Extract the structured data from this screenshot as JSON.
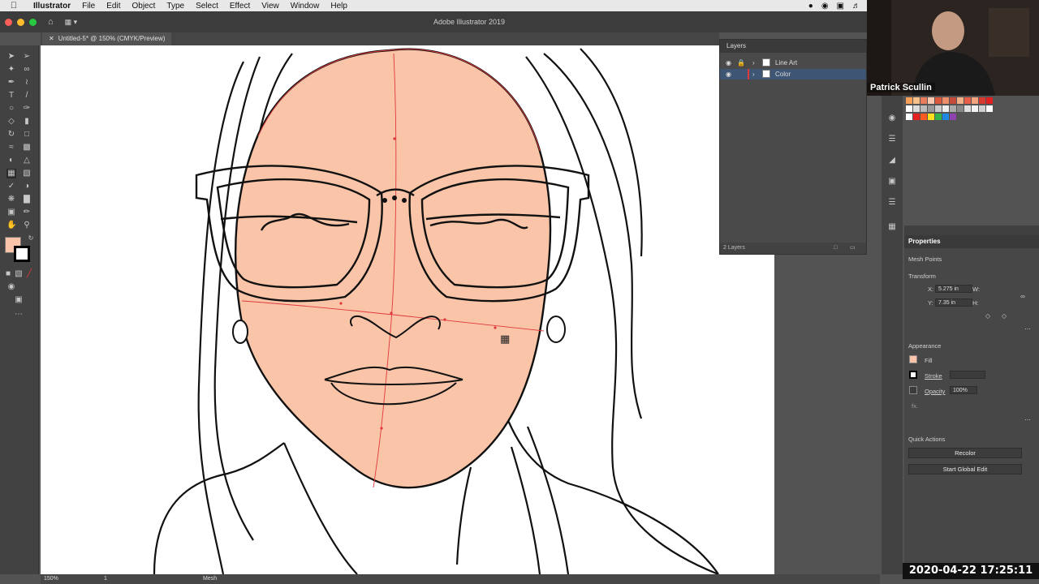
{
  "menubar": {
    "app": "Illustrator",
    "items": [
      "File",
      "Edit",
      "Object",
      "Type",
      "Select",
      "Effect",
      "View",
      "Window",
      "Help"
    ]
  },
  "window": {
    "title": "Adobe Illustrator 2019"
  },
  "document": {
    "tab": "Untitled-5* @ 150% (CMYK/Preview)"
  },
  "layers_panel": {
    "title": "Layers",
    "layers": [
      {
        "name": "Line Art",
        "selected": false
      },
      {
        "name": "Color",
        "selected": true
      }
    ],
    "count_label": "2 Layers"
  },
  "properties": {
    "tab": "Properties",
    "selection": "Mesh Points",
    "transform": {
      "label": "Transform",
      "x_label": "X:",
      "x": "5.275 in",
      "y_label": "Y:",
      "y": "7.35 in",
      "w_label": "W:",
      "h_label": "H:"
    },
    "appearance": {
      "label": "Appearance",
      "fill_label": "Fill",
      "stroke_label": "Stroke",
      "opacity_label": "Opacity",
      "opacity": "100%",
      "fx": "fx."
    },
    "quick_actions": {
      "label": "Quick Actions",
      "recolor": "Recolor",
      "global_edit": "Start Global Edit"
    }
  },
  "statusbar": {
    "zoom": "150%",
    "artboard": "1",
    "tool": "Mesh"
  },
  "webcam": {
    "name": "Patrick Scullin"
  },
  "timestamp": "2020-04-22  17:25:11",
  "colors": {
    "skin": "#F9C4A8",
    "mesh": "#E0393B",
    "panel": "#474747",
    "ui_dark": "#3c3c3c"
  }
}
